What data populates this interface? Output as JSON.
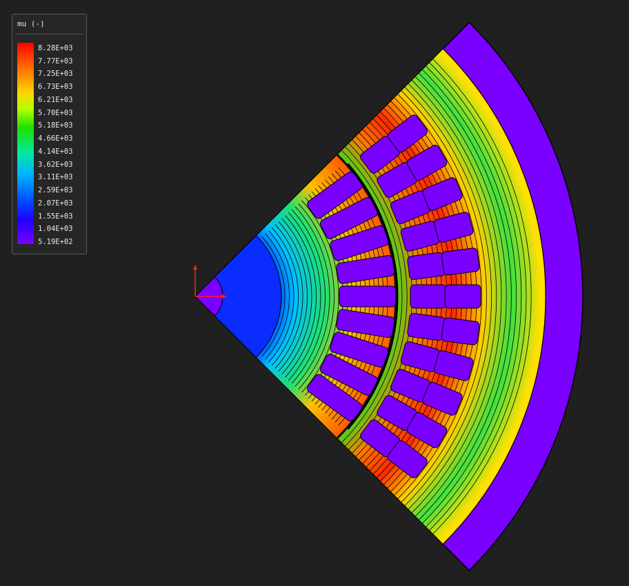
{
  "legend": {
    "title": "mu (-)",
    "ticks": [
      "8.28E+03",
      "7.77E+03",
      "7.25E+03",
      "6.73E+03",
      "6.21E+03",
      "5.70E+03",
      "5.18E+03",
      "4.66E+03",
      "4.14E+03",
      "3.62E+03",
      "3.11E+03",
      "2.59E+03",
      "2.07E+03",
      "1.55E+03",
      "1.04E+03",
      "5.19E+02"
    ]
  },
  "colors": {
    "background": "#202020",
    "slot_fill": "#7a00ff",
    "outer_ring": "#7a00ff",
    "axis": "#ff2020",
    "flux_line": "#000000"
  },
  "icons": {
    "origin_axes": "xy-axes-icon"
  }
}
